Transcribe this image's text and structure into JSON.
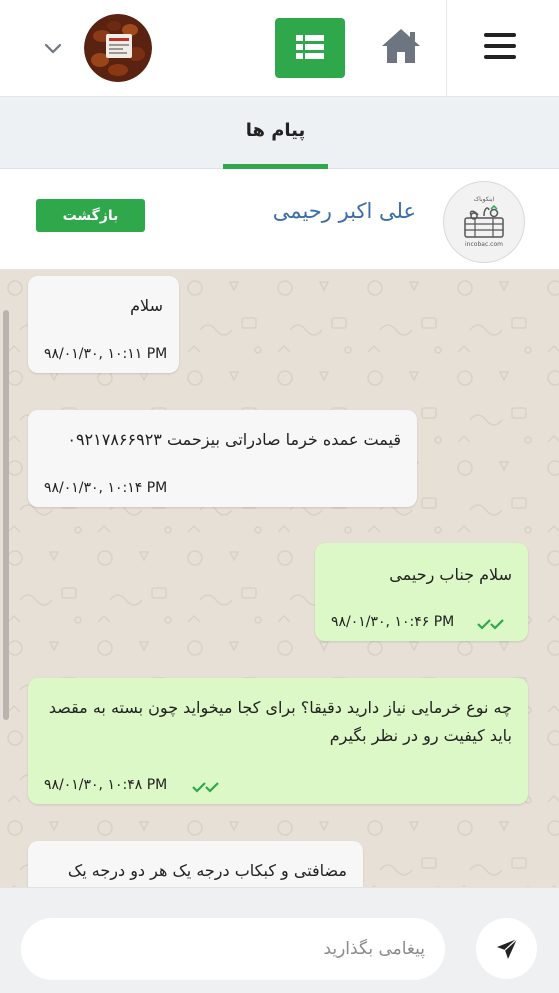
{
  "header": {
    "menu_icon": "hamburger-icon",
    "home_icon": "home-icon",
    "list_icon": "list-icon",
    "dropdown_icon": "chevron-down-icon",
    "accent_color": "#2ea84a"
  },
  "tabs": [
    {
      "label": "پیام ها",
      "active": true
    }
  ],
  "contact": {
    "name": "علی اکبر رحیمی",
    "back_label": "بازگشت",
    "avatar_brand_fa": "اینکوباک",
    "avatar_brand_en": "incobac.com"
  },
  "messages": [
    {
      "direction": "received",
      "text": "سلام",
      "time": "۹۸/۰۱/۳۰, ۱۰:۱۱ PM"
    },
    {
      "direction": "received",
      "text": "قیمت عمده خرما صادراتی بیزحمت ۰۹۲۱۷۸۶۶۹۲۳",
      "time": "۹۸/۰۱/۳۰, ۱۰:۱۴ PM"
    },
    {
      "direction": "sent",
      "text": "سلام جناب رحیمی",
      "time": "۹۸/۰۱/۳۰, ۱۰:۴۶ PM",
      "read": true
    },
    {
      "direction": "sent",
      "text": "چه نوع خرمایی نیاز دارید دقیقا؟ برای کجا میخواید چون بسته به مقصد باید کیفیت رو در نظر بگیرم",
      "time": "۹۸/۰۱/۳۰, ۱۰:۴۸ PM",
      "read": true
    },
    {
      "direction": "received",
      "text": "مضافتی و کبکاب درجه یک هر دو درجه یک",
      "time": ""
    }
  ],
  "composer": {
    "placeholder": "پیغامی بگذارید",
    "send_icon": "send-icon"
  },
  "colors": {
    "sent_bubble": "#dcf8c6",
    "received_bubble": "#f7f7f7",
    "tick_color": "#2ea84a",
    "contact_name": "#3b6ea8"
  }
}
